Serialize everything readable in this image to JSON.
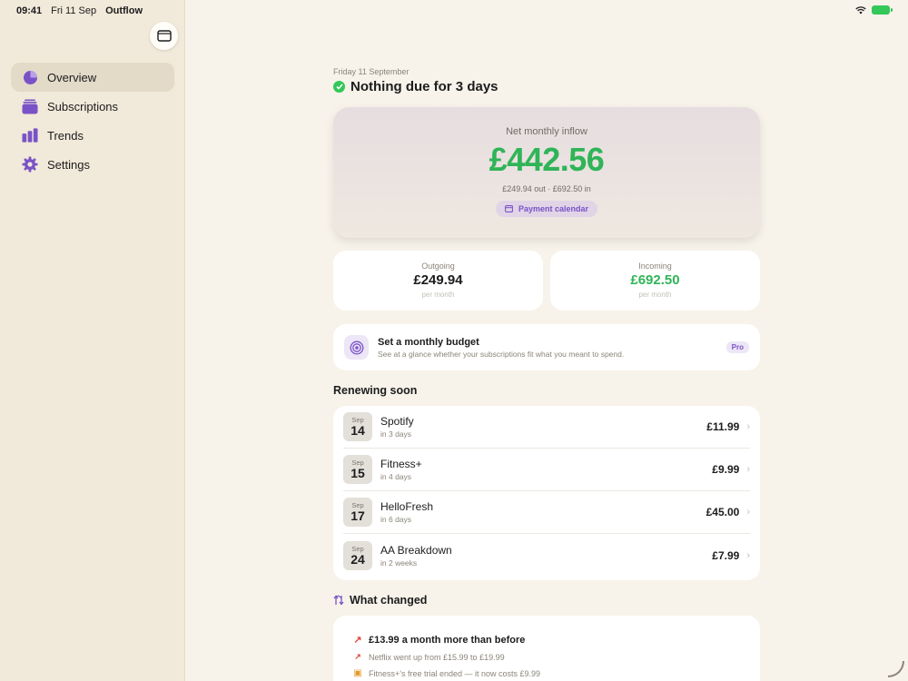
{
  "status": {
    "time": "09:41",
    "date": "Fri 11 Sep",
    "app": "Outflow"
  },
  "sidebar": {
    "items": [
      {
        "label": "Overview",
        "icon": "pie-chart-icon",
        "active": true
      },
      {
        "label": "Subscriptions",
        "icon": "stack-icon",
        "active": false
      },
      {
        "label": "Trends",
        "icon": "bar-chart-icon",
        "active": false
      },
      {
        "label": "Settings",
        "icon": "gear-icon",
        "active": false
      }
    ]
  },
  "header": {
    "date": "Friday 11 September",
    "title": "Nothing due for 3 days"
  },
  "hero": {
    "label": "Net monthly inflow",
    "amount": "£442.56",
    "sub": "£249.94 out · £692.50 in",
    "button": "Payment calendar"
  },
  "stats": {
    "outgoing": {
      "title": "Outgoing",
      "value": "£249.94",
      "period": "per month"
    },
    "incoming": {
      "title": "Incoming",
      "value": "£692.50",
      "period": "per month"
    }
  },
  "budget": {
    "title": "Set a monthly budget",
    "desc": "See at a glance whether your subscriptions fit what you meant to spend.",
    "badge": "Pro"
  },
  "renewing": {
    "title": "Renewing soon",
    "items": [
      {
        "month": "Sep",
        "day": "14",
        "name": "Spotify",
        "when": "in 3 days",
        "price": "£11.99"
      },
      {
        "month": "Sep",
        "day": "15",
        "name": "Fitness+",
        "when": "in 4 days",
        "price": "£9.99"
      },
      {
        "month": "Sep",
        "day": "17",
        "name": "HelloFresh",
        "when": "in 6 days",
        "price": "£45.00"
      },
      {
        "month": "Sep",
        "day": "24",
        "name": "AA Breakdown",
        "when": "in 2 weeks",
        "price": "£7.99"
      }
    ]
  },
  "changed": {
    "title": "What changed",
    "summary": "£13.99 a month more than before",
    "lines": [
      "Netflix went up from £15.99 to £19.99",
      "Fitness+'s free trial ended — it now costs £9.99"
    ]
  },
  "colors": {
    "accent": "#7a52c7",
    "positive": "#2fb457",
    "negative": "#e0463a"
  }
}
